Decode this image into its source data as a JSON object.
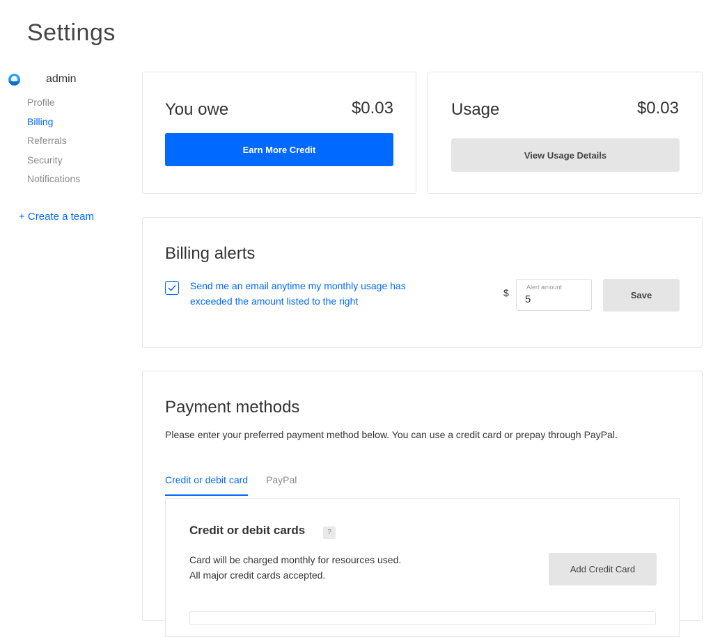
{
  "header": {
    "title": "Settings"
  },
  "sidebar": {
    "username": "admin",
    "items": [
      {
        "label": "Profile"
      },
      {
        "label": "Billing"
      },
      {
        "label": "Referrals"
      },
      {
        "label": "Security"
      },
      {
        "label": "Notifications"
      }
    ],
    "create_team": "+ Create a team"
  },
  "owe_card": {
    "label": "You owe",
    "amount": "$0.03",
    "button": "Earn More Credit"
  },
  "usage_card": {
    "label": "Usage",
    "amount": "$0.03",
    "button": "View Usage Details"
  },
  "billing_alerts": {
    "title": "Billing alerts",
    "checkbox_checked": true,
    "checkbox_text": "Send me an email anytime my monthly usage has exceeded the amount listed to the right",
    "currency": "$",
    "amount_label": "Alert amount",
    "amount_value": "5",
    "save_label": "Save"
  },
  "payment": {
    "title": "Payment methods",
    "description": "Please enter your preferred payment method below. You can use a credit card or prepay through PayPal.",
    "tabs": [
      {
        "label": "Credit or debit card"
      },
      {
        "label": "PayPal"
      }
    ],
    "cards_title": "Credit or debit cards",
    "help_label": "?",
    "cards_desc_line1": "Card will be charged monthly for resources used.",
    "cards_desc_line2": "All major credit cards accepted.",
    "add_card_label": "Add Credit Card"
  },
  "colors": {
    "accent": "#0069ff",
    "button_grey": "#e5e5e5",
    "border": "#e5e5e5"
  }
}
